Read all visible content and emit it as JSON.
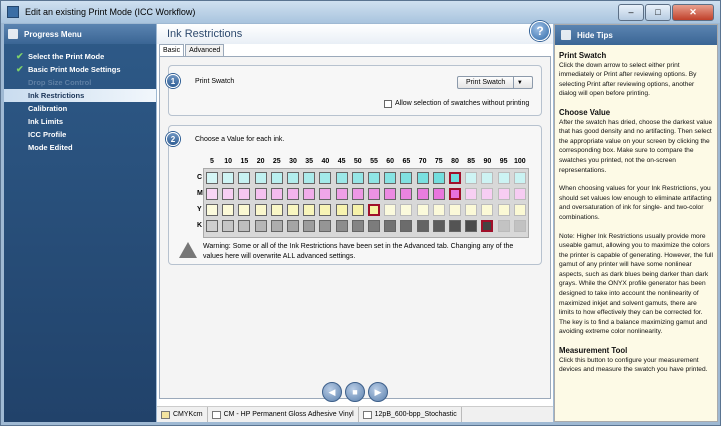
{
  "window": {
    "title": "Edit an existing Print Mode (ICC Workflow)",
    "min_glyph": "–",
    "max_glyph": "□",
    "close_glyph": "✕"
  },
  "sidebar": {
    "title": "Progress Menu",
    "steps": [
      {
        "label": "Select the Print Mode",
        "done": true,
        "state": "done"
      },
      {
        "label": "Basic Print Mode Settings",
        "done": true,
        "state": "done"
      },
      {
        "label": "Drop Size Control",
        "done": false,
        "state": "dim"
      },
      {
        "label": "Ink Restrictions",
        "done": false,
        "state": "active"
      },
      {
        "label": "Calibration",
        "done": false,
        "state": "normal"
      },
      {
        "label": "Ink Limits",
        "done": false,
        "state": "normal"
      },
      {
        "label": "ICC Profile",
        "done": false,
        "state": "normal"
      },
      {
        "label": "Mode Edited",
        "done": false,
        "state": "normal"
      }
    ],
    "check_glyph": "✔"
  },
  "main": {
    "title": "Ink Restrictions",
    "tabs": [
      "Basic",
      "Advanced"
    ],
    "help_glyph": "?",
    "step1": {
      "number": "1",
      "label": "Print Swatch",
      "button": "Print Swatch",
      "dropdown_glyph": "▼",
      "checkbox_label": "Allow selection of swatches without printing"
    },
    "step2": {
      "number": "2",
      "label": "Choose a Value for each ink.",
      "columns": [
        "5",
        "10",
        "15",
        "20",
        "25",
        "30",
        "35",
        "40",
        "45",
        "50",
        "55",
        "60",
        "65",
        "70",
        "75",
        "80",
        "85",
        "90",
        "95",
        "100"
      ],
      "rows": [
        {
          "ink": "C",
          "color": "#4fd6d6",
          "selected_value": "80"
        },
        {
          "ink": "M",
          "color": "#e254d4",
          "selected_value": "80"
        },
        {
          "ink": "Y",
          "color": "#f0ea70",
          "selected_value": "55"
        },
        {
          "ink": "K",
          "color": "#333333",
          "selected_value": "90"
        }
      ],
      "warning": "Warning: Some or all of the Ink Restrictions have been set in the Advanced tab. Changing any of the values here will overwrite ALL advanced settings."
    }
  },
  "nav": {
    "back_glyph": "◀",
    "stop_glyph": "■",
    "next_glyph": "▶"
  },
  "status": [
    "CMYKcm",
    "CM - HP Permanent Gloss Adhesive Vinyl",
    "12pB_600-bpp_Stochastic"
  ],
  "tips": {
    "header": "Hide Tips",
    "sections": [
      {
        "title": "Print Swatch",
        "paragraphs": [
          "Click the down arrow to select either print immediately or Print after reviewing options. By selecting Print after reviewing options, another dialog will open before printing."
        ]
      },
      {
        "title": "Choose Value",
        "paragraphs": [
          "After the swatch has dried, choose the darkest value that has good density and no artifacting. Then select the appropriate value on your screen by clicking the corresponding box. Make sure to compare the swatches you printed, not the on-screen representations.",
          "When choosing values for your Ink Restrictions, you should set values low enough to eliminate artifacting and oversaturation of ink for single- and two-color combinations.",
          "Note: Higher Ink Restrictions usually provide more useable gamut, allowing you to maximize the colors the printer is capable of generating. However, the full gamut of any printer will have some nonlinear aspects, such as dark blues being darker than dark grays. While the ONYX profile generator has been designed to take into account the nonlinearity of maximized inkjet and solvent gamuts, there are limits to how effectively they can be corrected for. The key is to find a balance maximizing gamut and avoiding extreme color nonlinearity."
        ]
      },
      {
        "title": "Measurement Tool",
        "paragraphs": [
          "Click this button to configure your measurement devices and measure the swatch you have printed."
        ]
      }
    ]
  }
}
